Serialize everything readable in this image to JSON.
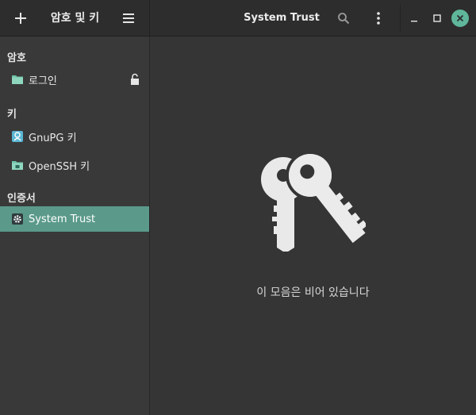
{
  "header": {
    "left_title": "암호 및 키",
    "right_title": "System Trust"
  },
  "icons": {
    "add": "plus-icon",
    "menu": "hamburger-menu-icon",
    "search": "search-icon",
    "more": "kebab-menu-icon",
    "minimize": "minimize-icon",
    "maximize": "maximize-icon",
    "close": "close-icon"
  },
  "sidebar": {
    "sections": [
      {
        "header": "암호",
        "items": [
          {
            "label": "로그인",
            "icon": "folder-icon",
            "locked": false
          }
        ]
      },
      {
        "header": "키",
        "items": [
          {
            "label": "GnuPG 키",
            "icon": "gnupg-key-icon"
          },
          {
            "label": "OpenSSH 키",
            "icon": "openssh-key-icon"
          }
        ]
      },
      {
        "header": "인증서",
        "items": [
          {
            "label": "System Trust",
            "icon": "certificate-gear-icon",
            "selected": true
          }
        ]
      }
    ]
  },
  "main": {
    "empty_message": "이 모음은 비어 있습니다"
  },
  "colors": {
    "accent": "#5b9a8a",
    "close_button": "#5fb79b",
    "folder": "#6fc2a8"
  }
}
